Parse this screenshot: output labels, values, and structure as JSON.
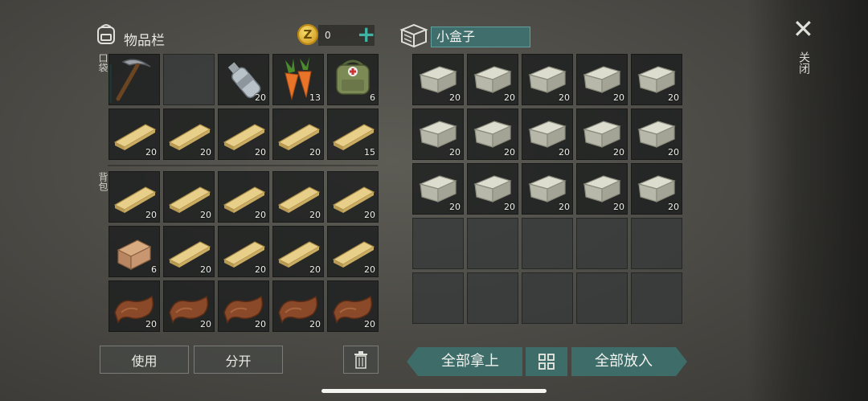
{
  "inventory": {
    "title": "物品栏",
    "coins": "0",
    "add_icon": "plus-icon",
    "backpack_icon": "backpack-icon",
    "pocket_label": "口袋",
    "backpack_label": "背包",
    "slots": [
      {
        "item": "pickaxe",
        "count": ""
      },
      {
        "item": "",
        "count": ""
      },
      {
        "item": "water-bottle",
        "count": "20"
      },
      {
        "item": "carrot",
        "count": "13"
      },
      {
        "item": "first-aid-bag",
        "count": "6"
      },
      {
        "item": "plank",
        "count": "20"
      },
      {
        "item": "plank",
        "count": "20"
      },
      {
        "item": "plank",
        "count": "20"
      },
      {
        "item": "plank",
        "count": "20"
      },
      {
        "item": "plank",
        "count": "15"
      },
      {
        "item": "plank",
        "count": "20"
      },
      {
        "item": "plank",
        "count": "20"
      },
      {
        "item": "plank",
        "count": "20"
      },
      {
        "item": "plank",
        "count": "20"
      },
      {
        "item": "plank",
        "count": "20"
      },
      {
        "item": "log",
        "count": "6"
      },
      {
        "item": "plank",
        "count": "20"
      },
      {
        "item": "plank",
        "count": "20"
      },
      {
        "item": "plank",
        "count": "20"
      },
      {
        "item": "plank",
        "count": "20"
      },
      {
        "item": "leather",
        "count": "20"
      },
      {
        "item": "leather",
        "count": "20"
      },
      {
        "item": "leather",
        "count": "20"
      },
      {
        "item": "leather",
        "count": "20"
      },
      {
        "item": "leather",
        "count": "20"
      }
    ],
    "use_label": "使用",
    "split_label": "分开",
    "trash_icon": "trash-icon"
  },
  "container": {
    "icon": "box-icon",
    "name": "小盒子",
    "slots": [
      {
        "item": "stone",
        "count": "20"
      },
      {
        "item": "stone",
        "count": "20"
      },
      {
        "item": "stone",
        "count": "20"
      },
      {
        "item": "stone",
        "count": "20"
      },
      {
        "item": "stone",
        "count": "20"
      },
      {
        "item": "stone",
        "count": "20"
      },
      {
        "item": "stone",
        "count": "20"
      },
      {
        "item": "stone",
        "count": "20"
      },
      {
        "item": "stone",
        "count": "20"
      },
      {
        "item": "stone",
        "count": "20"
      },
      {
        "item": "stone",
        "count": "20"
      },
      {
        "item": "stone",
        "count": "20"
      },
      {
        "item": "stone",
        "count": "20"
      },
      {
        "item": "stone",
        "count": "20"
      },
      {
        "item": "stone",
        "count": "20"
      },
      {
        "item": "",
        "count": ""
      },
      {
        "item": "",
        "count": ""
      },
      {
        "item": "",
        "count": ""
      },
      {
        "item": "",
        "count": ""
      },
      {
        "item": "",
        "count": ""
      },
      {
        "item": "",
        "count": ""
      },
      {
        "item": "",
        "count": ""
      },
      {
        "item": "",
        "count": ""
      },
      {
        "item": "",
        "count": ""
      },
      {
        "item": "",
        "count": ""
      }
    ],
    "take_all_label": "全部拿上",
    "sort_icon": "grid-icon",
    "put_all_label": "全部放入"
  },
  "window": {
    "close_label": "关闭",
    "close_icon": "close-icon"
  },
  "colors": {
    "accent": "#3d6c69",
    "plus": "#3fb4a4",
    "coin": "#d6a22a"
  }
}
